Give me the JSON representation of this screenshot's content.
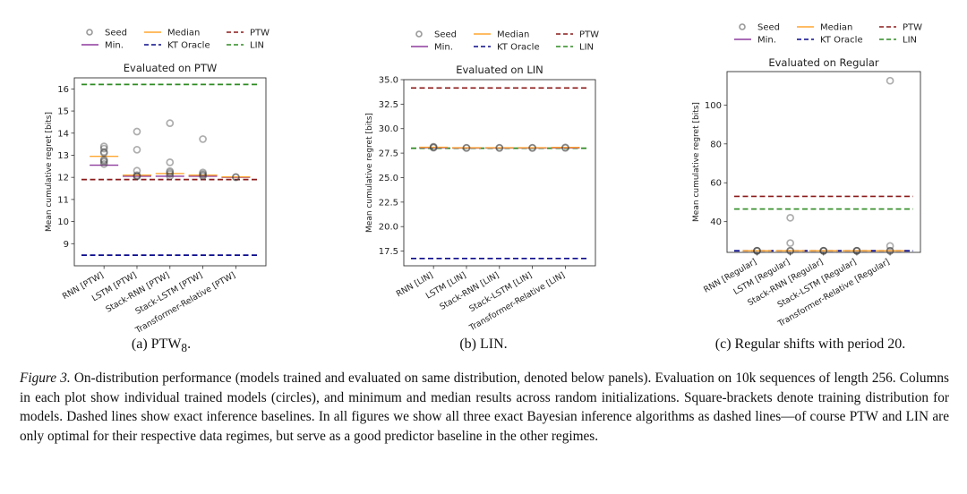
{
  "legend": {
    "seed": "Seed",
    "median": "Median",
    "ptw": "PTW",
    "min": "Min.",
    "kt": "KT Oracle",
    "lin": "LIN"
  },
  "colors": {
    "seed": "#999999",
    "median": "#ffa630",
    "min": "#8e3a9e",
    "ptw": "#8b1a1a",
    "kt": "#0a0a8c",
    "lin": "#2e8b22"
  },
  "chart_data": [
    {
      "type": "scatter",
      "title": "Evaluated on PTW",
      "ylabel": "Mean cumulative regret [bits]",
      "ylim": [
        8.0,
        16.5
      ],
      "yticks": [
        9,
        10,
        11,
        12,
        13,
        14,
        15,
        16
      ],
      "categories": [
        "RNN [PTW]",
        "LSTM [PTW]",
        "Stack-RNN [PTW]",
        "Stack-LSTM [PTW]",
        "Transformer-Relative [PTW]"
      ],
      "seeds": [
        [
          13.4,
          13.3,
          13.15,
          13.1,
          12.8,
          12.75,
          12.7,
          12.6
        ],
        [
          14.07,
          13.25,
          12.3,
          12.1,
          12.05,
          12.05
        ],
        [
          14.45,
          12.68,
          12.28,
          12.22,
          12.15,
          12.05
        ],
        [
          13.73,
          12.22,
          12.15,
          12.1,
          12.05
        ],
        [
          12.02,
          12.0
        ]
      ],
      "min": [
        12.55,
        12.05,
        12.05,
        12.05,
        12.0
      ],
      "median": [
        12.95,
        12.1,
        12.17,
        12.1,
        12.02
      ],
      "baselines": {
        "ptw": 11.9,
        "kt": 8.48,
        "lin": 16.2
      },
      "legend_position": "top",
      "subcaption": "(a) PTW",
      "subcaption_sub": "8",
      "subcaption_end": "."
    },
    {
      "type": "scatter",
      "title": "Evaluated on LIN",
      "ylabel": "Mean cumulative regret [bits]",
      "ylim": [
        16.0,
        35.0
      ],
      "yticks": [
        17.5,
        20.0,
        22.5,
        25.0,
        27.5,
        30.0,
        32.5,
        35.0
      ],
      "categories": [
        "RNN [LIN]",
        "LSTM [LIN]",
        "Stack-RNN [LIN]",
        "Stack-LSTM [LIN]",
        "Transformer-Relative [LIN]"
      ],
      "seeds": [
        [
          28.15,
          28.1,
          28.05
        ],
        [
          28.05,
          28.02
        ],
        [
          28.05,
          28.02
        ],
        [
          28.05,
          28.02
        ],
        [
          28.08,
          28.03
        ]
      ],
      "min": [
        28.05,
        28.02,
        28.02,
        28.02,
        28.03
      ],
      "median": [
        28.1,
        28.05,
        28.05,
        28.05,
        28.08
      ],
      "baselines": {
        "ptw": 34.15,
        "kt": 16.75,
        "lin": 28.0
      },
      "legend_position": "top",
      "subcaption": "(b) LIN",
      "subcaption_sub": "",
      "subcaption_end": "."
    },
    {
      "type": "scatter",
      "title": "Evaluated on Regular",
      "ylabel": "Mean cumulative regret [bits]",
      "ylim": [
        24.2,
        117.2
      ],
      "yticks": [
        40,
        60,
        80,
        100
      ],
      "categories": [
        "RNN [Regular]",
        "LSTM [Regular]",
        "Stack-RNN [Regular]",
        "Stack-LSTM [Regular]",
        "Transformer-Relative [Regular]"
      ],
      "seeds": [
        [
          25,
          25,
          25
        ],
        [
          42,
          29,
          25,
          25
        ],
        [
          25,
          25,
          25
        ],
        [
          25,
          25,
          25
        ],
        [
          112.5,
          27.5,
          25,
          25
        ]
      ],
      "min": [
        25,
        25,
        25,
        25,
        25
      ],
      "median": [
        25,
        25,
        25,
        25,
        25
      ],
      "baselines": {
        "ptw": 53,
        "kt": 25,
        "lin": 46.5
      },
      "legend_position": "top",
      "subcaption": "(c) Regular shifts with period 20.",
      "subcaption_sub": "",
      "subcaption_end": ""
    }
  ],
  "caption": {
    "label": "Figure 3.",
    "text1": " On-distribution performance (models trained and evaluated on same distribution, denoted below panels). Evaluation on 10k sequences of length 256. Columns in each plot show individual trained models (circles), and minimum and median results across random initializations. Square-brackets denote training distribution for models. Dashed lines show exact inference baselines. In all figures we show all three exact Bayesian inference algorithms as dashed lines—of course ",
    "ptw": "PTW",
    "and": " and ",
    "lin": "LIN",
    "text2": " are only optimal for their respective data regimes, but serve as a good predictor baseline in the other regimes."
  }
}
